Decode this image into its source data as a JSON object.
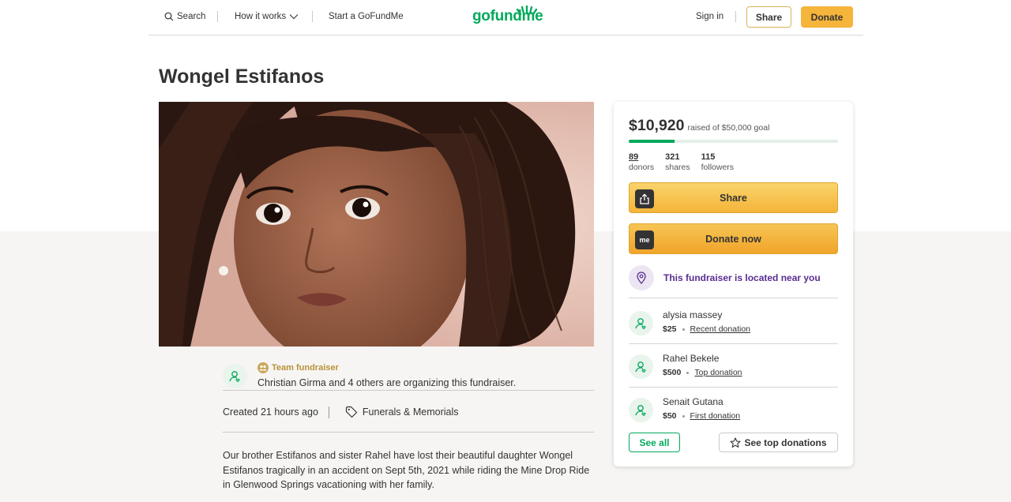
{
  "header": {
    "search_label": "Search",
    "how_it_works_label": "How it works",
    "start_label": "Start a GoFundMe",
    "logo_text": "gofundme",
    "signin_label": "Sign in",
    "share_label": "Share",
    "donate_label": "Donate"
  },
  "campaign": {
    "title": "Wongel Estifanos",
    "team_label": "Team fundraiser",
    "organizer_text": "Christian Girma and 4 others are organizing this fundraiser.",
    "created": "Created 21 hours ago",
    "category": "Funerals & Memorials",
    "story": "Our brother Estifanos and sister Rahel have lost their beautiful daughter Wongel Estifanos tragically in an accident on Sept 5th, 2021 while riding the Mine Drop Ride in Glenwood Springs vacationing with her family."
  },
  "sidebar": {
    "raised_amount": "$10,920",
    "raised_goal_text": "raised of $50,000 goal",
    "progress_fraction": 0.2184,
    "stats": [
      {
        "num": "89",
        "label": "donors"
      },
      {
        "num": "321",
        "label": "shares"
      },
      {
        "num": "115",
        "label": "followers"
      }
    ],
    "share_button": "Share",
    "donate_button": "Donate now",
    "donate_icon_text": "me",
    "location_text": "This fundraiser is located near you",
    "donations": [
      {
        "name": "alysia massey",
        "amount": "$25",
        "type": "Recent donation"
      },
      {
        "name": "Rahel Bekele",
        "amount": "$500",
        "type": "Top donation"
      },
      {
        "name": "Senait Gutana",
        "amount": "$50",
        "type": "First donation"
      }
    ],
    "see_all_label": "See all",
    "see_top_label": "See top donations"
  },
  "colors": {
    "brand_green": "#02a95c",
    "donate_orange": "#f5b43a",
    "location_purple": "#5a2d91"
  }
}
